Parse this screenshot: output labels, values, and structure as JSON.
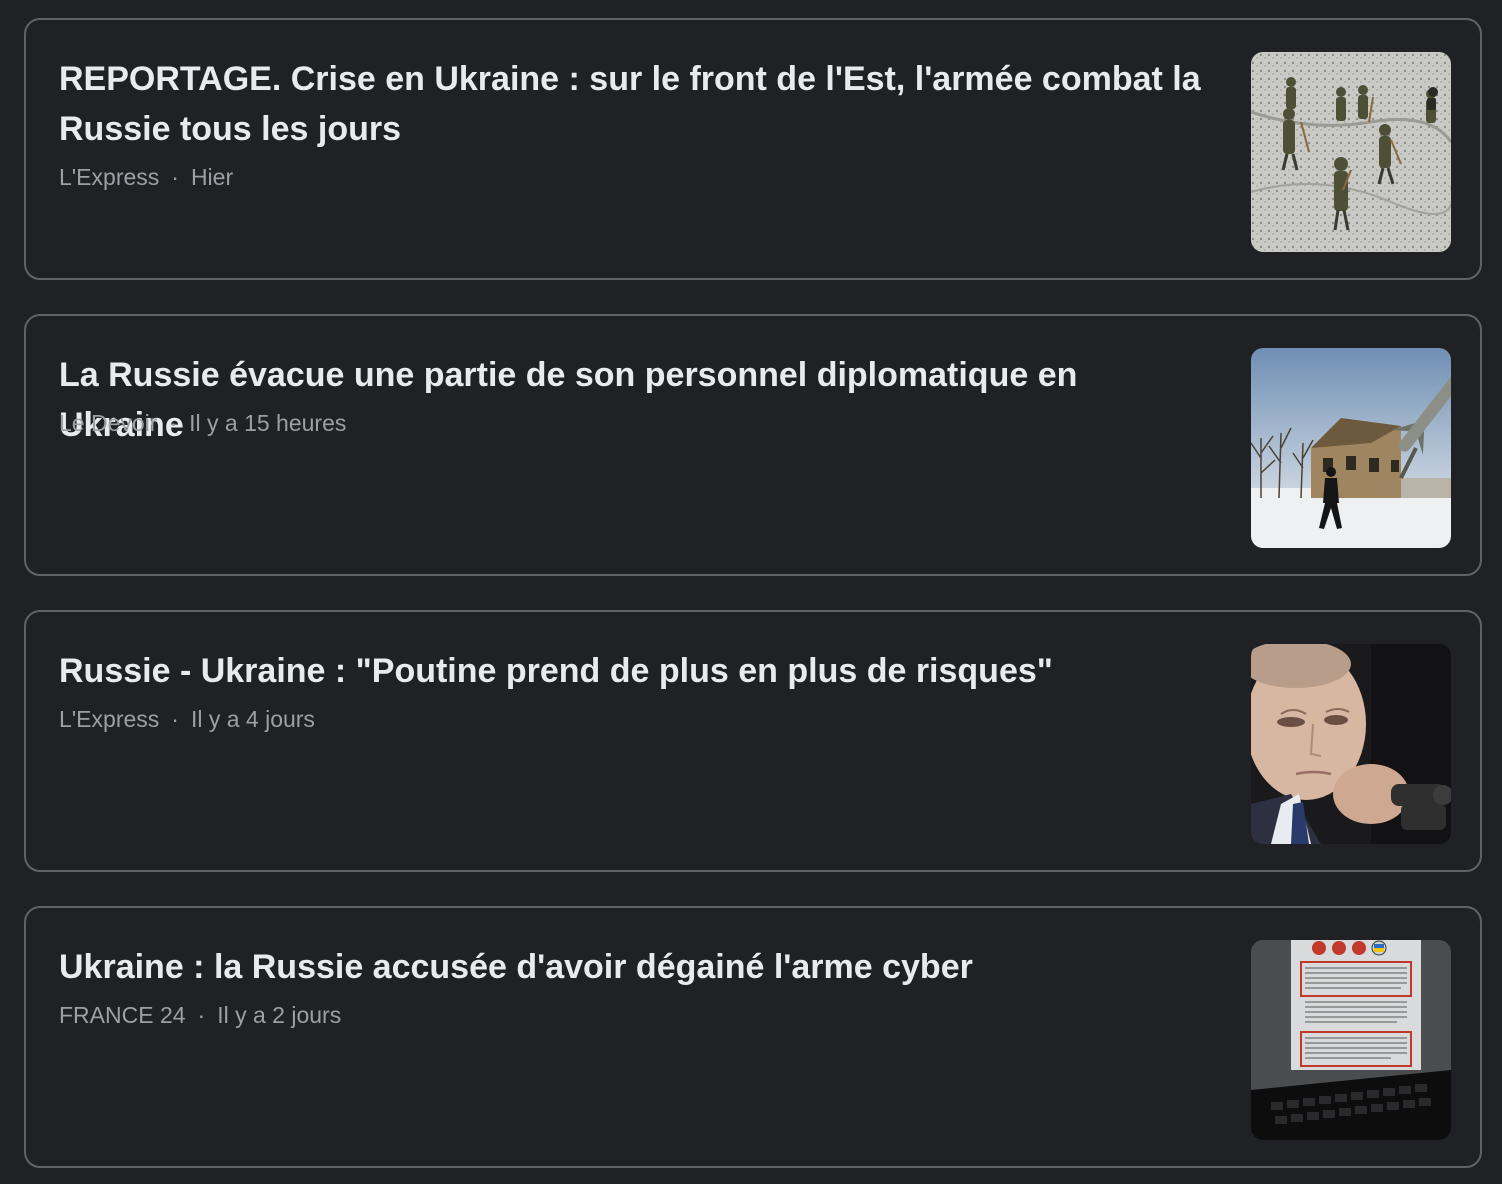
{
  "articles": [
    {
      "headline": "REPORTAGE. Crise en Ukraine : sur le front de l'Est, l'armée combat la Russie tous les jours",
      "source": "L'Express",
      "separator": "·",
      "time": "Hier",
      "thumbnail_icon": "soldiers-in-snow-photo"
    },
    {
      "headline": "La Russie évacue une partie de son personnel diplomatique en Ukraine",
      "source": "Le Devoir",
      "separator": "·",
      "time": "Il y a 15 heures",
      "thumbnail_icon": "ruined-building-missile-photo"
    },
    {
      "headline": "Russie - Ukraine : \"Poutine prend de plus en plus de risques\"",
      "source": "L'Express",
      "separator": "·",
      "time": "Il y a 4 jours",
      "thumbnail_icon": "portrait-with-binoculars-photo"
    },
    {
      "headline": "Ukraine : la Russie accusée d'avoir dégainé l'arme cyber",
      "source": "FRANCE 24",
      "separator": "·",
      "time": "Il y a 2 jours",
      "thumbnail_icon": "laptop-hacked-screen-photo"
    }
  ],
  "colors": {
    "background": "#202124",
    "card_border": "#5f6368",
    "headline": "#e8eaed",
    "meta": "#9aa0a6"
  }
}
